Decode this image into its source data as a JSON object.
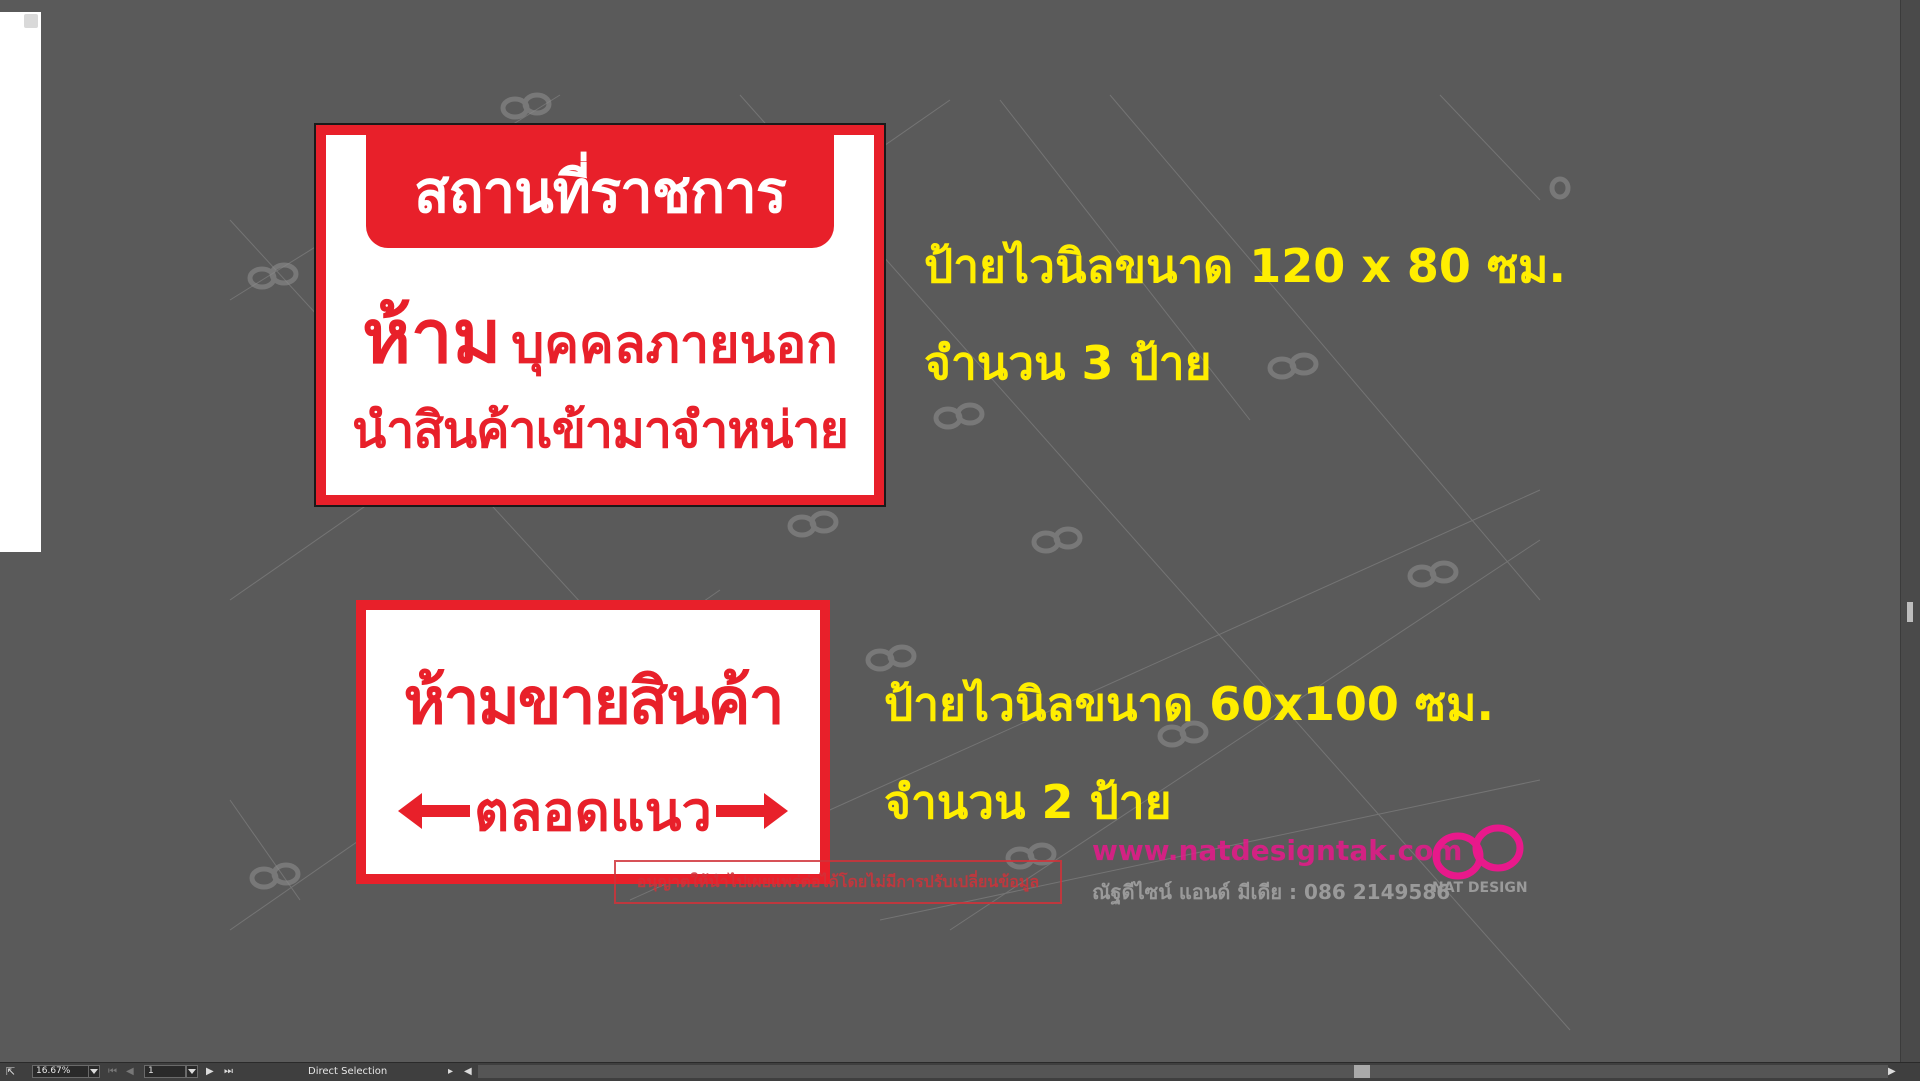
{
  "sign1": {
    "header": "สถานที่ราชการ",
    "line2_big": "ห้าม",
    "line2_small": "บุคคลภายนอก",
    "line3": "นำสินค้าเข้ามาจำหน่าย"
  },
  "caption1": {
    "size": "ป้ายไวนิลขนาด 120 x 80 ซม.",
    "quantity": "จำนวน 3 ป้าย"
  },
  "sign2": {
    "line1": "ห้ามขายสินค้า",
    "line2": "ตลอดแนว"
  },
  "caption2": {
    "size": "ป้ายไวนิลขนาด 60x100 ซม.",
    "quantity": "จำนวน 2 ป้าย"
  },
  "disclaimer": "อนุญาตให้นำไปเผยแพร่ต่อได้โดยไม่มีการปรับเปลี่ยนข้อมูล",
  "branding": {
    "url": "www.natdesigntak.com",
    "subtitle": "ณัฐดีไซน์ แอนด์ มีเดีย : 086 2149586",
    "logo_text": "NAT DESIGN"
  },
  "colors": {
    "sign_red": "#e8202a",
    "caption_yellow": "#ffee00",
    "brand_magenta": "#e8198b",
    "canvas_gray": "#5a5a5a"
  },
  "statusbar": {
    "zoom": "16.67%",
    "page": "1",
    "tool": "Direct Selection"
  }
}
